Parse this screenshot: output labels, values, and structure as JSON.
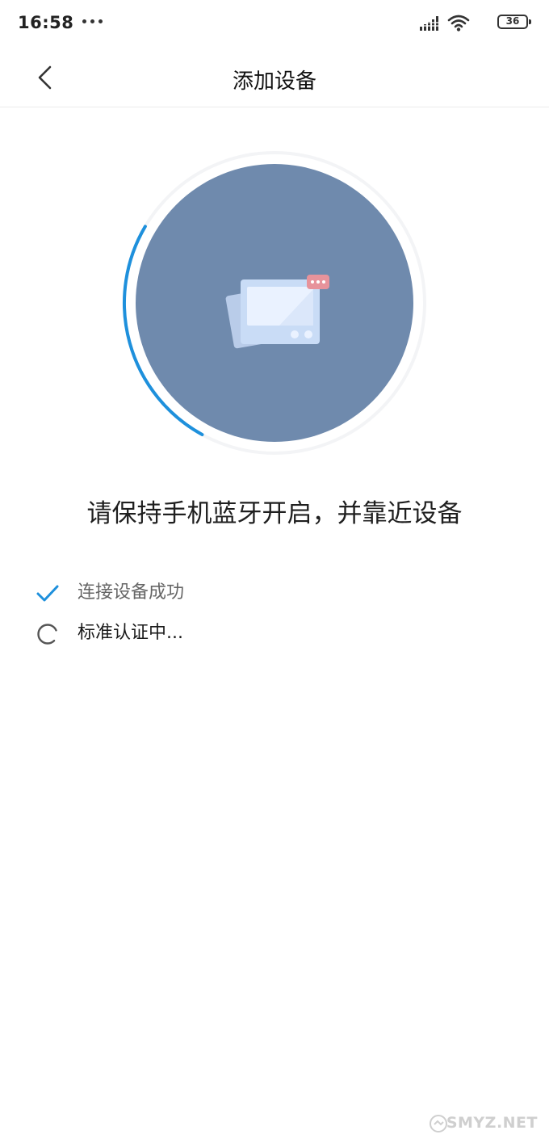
{
  "status_bar": {
    "time": "16:58",
    "battery_level": "36",
    "icons": [
      "more-dots-icon",
      "signal-icon",
      "wifi-icon",
      "battery-icon"
    ]
  },
  "header": {
    "title": "添加设备",
    "back_icon": "chevron-left-icon"
  },
  "pairing": {
    "device_icon": "device-screen-icon",
    "progress": 0.17,
    "colors": {
      "circle": "#6f8aad",
      "arc": "#1e90dc",
      "track": "#f2f4f7"
    }
  },
  "hint": "请保持手机蓝牙开启，并靠近设备",
  "steps": [
    {
      "label": "连接设备成功",
      "state": "done",
      "icon": "check-icon"
    },
    {
      "label": "标准认证中...",
      "state": "in-progress",
      "icon": "spinner-icon"
    }
  ],
  "watermark": {
    "text": "SMYZ.NET",
    "logo": "watermark-logo-icon"
  }
}
